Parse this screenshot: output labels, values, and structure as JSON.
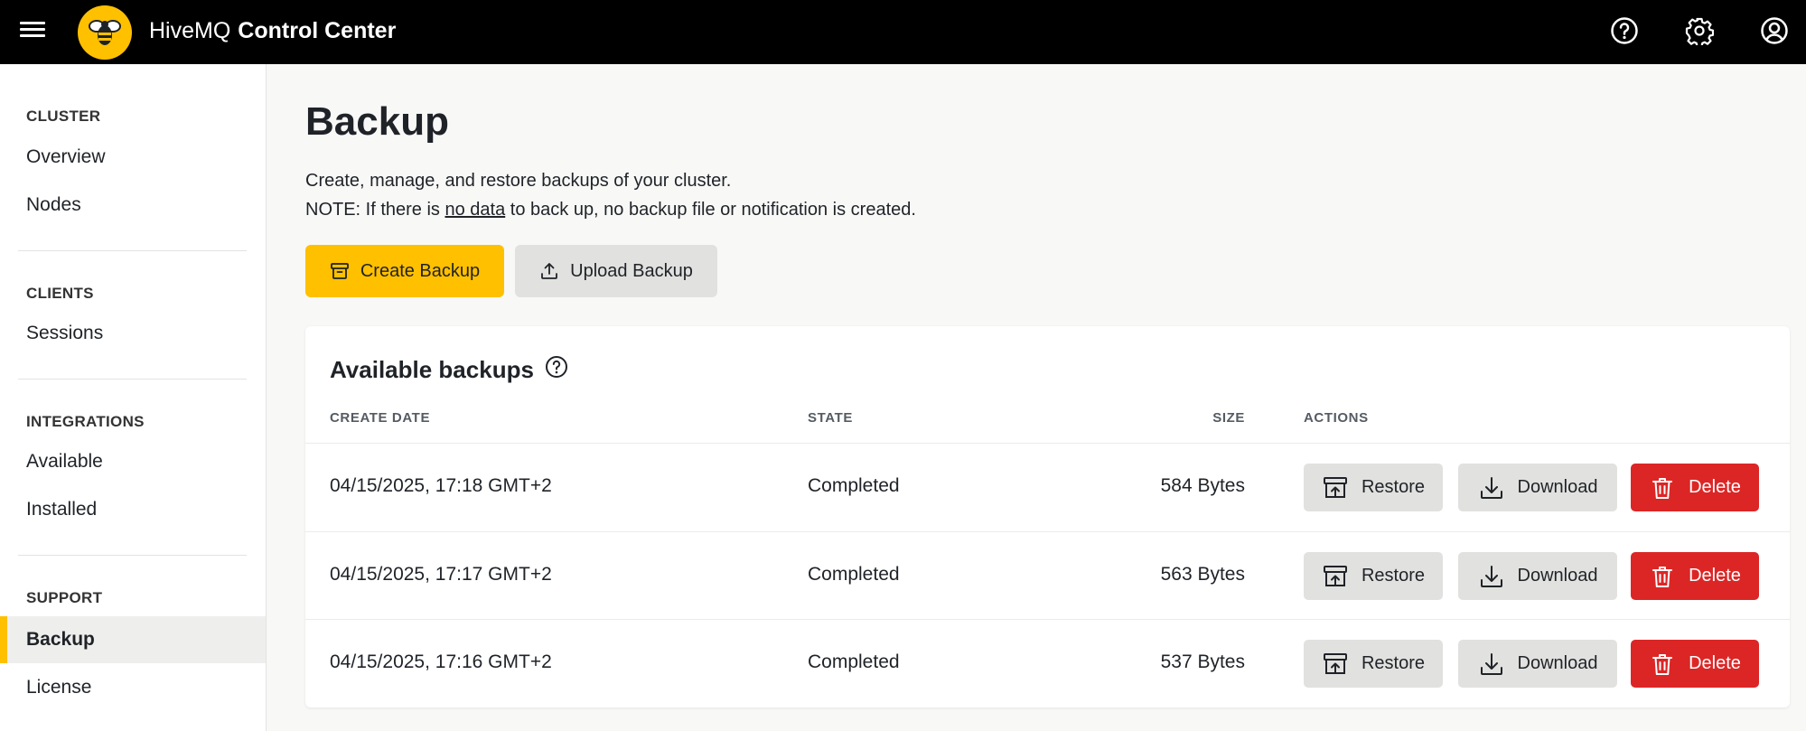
{
  "header": {
    "brand_light": "HiveMQ",
    "brand_bold": "Control Center",
    "icons": [
      "menu-icon",
      "help-icon",
      "settings-icon",
      "account-icon"
    ]
  },
  "sidebar": {
    "sections": [
      {
        "title": "CLUSTER",
        "items": [
          "Overview",
          "Nodes"
        ]
      },
      {
        "title": "CLIENTS",
        "items": [
          "Sessions"
        ]
      },
      {
        "title": "INTEGRATIONS",
        "items": [
          "Available",
          "Installed"
        ]
      },
      {
        "title": "SUPPORT",
        "items": [
          "Backup",
          "License"
        ]
      }
    ],
    "active_item": "Backup"
  },
  "main": {
    "title": "Backup",
    "description_line1": "Create, manage, and restore backups of your cluster.",
    "note_prefix": "NOTE: If there is ",
    "note_link": "no data",
    "note_suffix": " to back up, no backup file or notification is created.",
    "create_label": "Create Backup",
    "upload_label": "Upload Backup"
  },
  "table": {
    "title": "Available backups",
    "columns": [
      "CREATE DATE",
      "STATE",
      "SIZE",
      "ACTIONS"
    ],
    "rows": [
      {
        "date": "04/15/2025, 17:18 GMT+2",
        "state": "Completed",
        "size": "584 Bytes"
      },
      {
        "date": "04/15/2025, 17:17 GMT+2",
        "state": "Completed",
        "size": "563 Bytes"
      },
      {
        "date": "04/15/2025, 17:16 GMT+2",
        "state": "Completed",
        "size": "537 Bytes"
      }
    ],
    "actions": {
      "restore": "Restore",
      "download": "Download",
      "delete": "Delete"
    }
  },
  "colors": {
    "accent": "#ffc000",
    "danger": "#dc2626",
    "topbar": "#000000"
  }
}
